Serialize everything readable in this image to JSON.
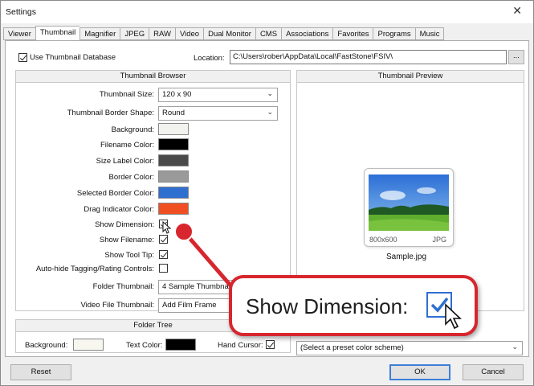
{
  "window": {
    "title": "Settings",
    "close": "✕"
  },
  "tabs": [
    "Viewer",
    "Thumbnail",
    "Magnifier",
    "JPEG",
    "RAW",
    "Video",
    "Dual Monitor",
    "CMS",
    "Associations",
    "Favorites",
    "Programs",
    "Music"
  ],
  "active_tab": "Thumbnail",
  "top": {
    "use_db_label": "Use Thumbnail Database",
    "use_db_checked": true,
    "location_label": "Location:",
    "location_value": "C:\\Users\\rober\\AppData\\Local\\FastStone\\FSIV\\",
    "browse_label": "..."
  },
  "browser": {
    "title": "Thumbnail Browser",
    "size_label": "Thumbnail Size:",
    "size_value": "120 x 90",
    "border_shape_label": "Thumbnail Border Shape:",
    "border_shape_value": "Round",
    "colors": [
      {
        "label": "Background:",
        "color": "#f2f2ee"
      },
      {
        "label": "Filename Color:",
        "color": "#000000"
      },
      {
        "label": "Size Label Color:",
        "color": "#4a4a4a"
      },
      {
        "label": "Border Color:",
        "color": "#9a9a9a"
      },
      {
        "label": "Selected Border Color:",
        "color": "#2f6fd0"
      },
      {
        "label": "Drag Indicator Color:",
        "color": "#ef4f23"
      }
    ],
    "show_dimension_label": "Show Dimension:",
    "show_dimension_checked": true,
    "show_filename_label": "Show Filename:",
    "show_filename_checked": true,
    "show_tooltip_label": "Show Tool Tip:",
    "show_tooltip_checked": true,
    "autohide_label": "Auto-hide Tagging/Rating Controls:",
    "autohide_checked": false,
    "folder_thumb_label": "Folder Thumbnail:",
    "folder_thumb_value": "4 Sample Thumbnails",
    "video_thumb_label": "Video File Thumbnail:",
    "video_thumb_value": "Add Film Frame"
  },
  "preview": {
    "title": "Thumbnail Preview",
    "dimension": "800x600",
    "type": "JPG",
    "filename": "Sample.jpg"
  },
  "folder_tree": {
    "title": "Folder Tree",
    "bg_label": "Background:",
    "bg_color": "#f7f7f0",
    "text_color_label": "Text Color:",
    "text_color": "#000000",
    "hand_cursor_label": "Hand Cursor:",
    "hand_cursor_checked": true
  },
  "scheme": {
    "value": "(Select a preset color scheme)"
  },
  "buttons": {
    "reset": "Reset",
    "ok": "OK",
    "cancel": "Cancel"
  },
  "callout": {
    "text": "Show Dimension:",
    "color": "#d7262e"
  }
}
